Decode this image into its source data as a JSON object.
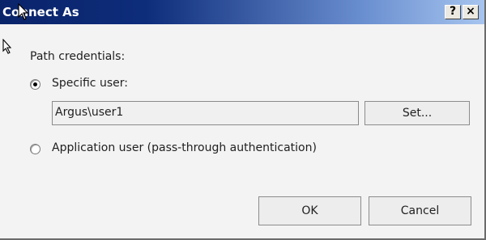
{
  "window": {
    "title": "Connect As",
    "help_label": "?",
    "close_label": "×"
  },
  "group": {
    "label": "Path credentials:"
  },
  "options": {
    "specific_user": {
      "label": "Specific user:",
      "selected": true
    },
    "application_user": {
      "label": "Application user (pass-through authentication)",
      "selected": false
    }
  },
  "user_field": {
    "value": "Argus\\user1"
  },
  "buttons": {
    "set_label": "Set...",
    "ok_label": "OK",
    "cancel_label": "Cancel"
  },
  "icons": {
    "mouse_cursor": "mouse-cursor-icon"
  }
}
